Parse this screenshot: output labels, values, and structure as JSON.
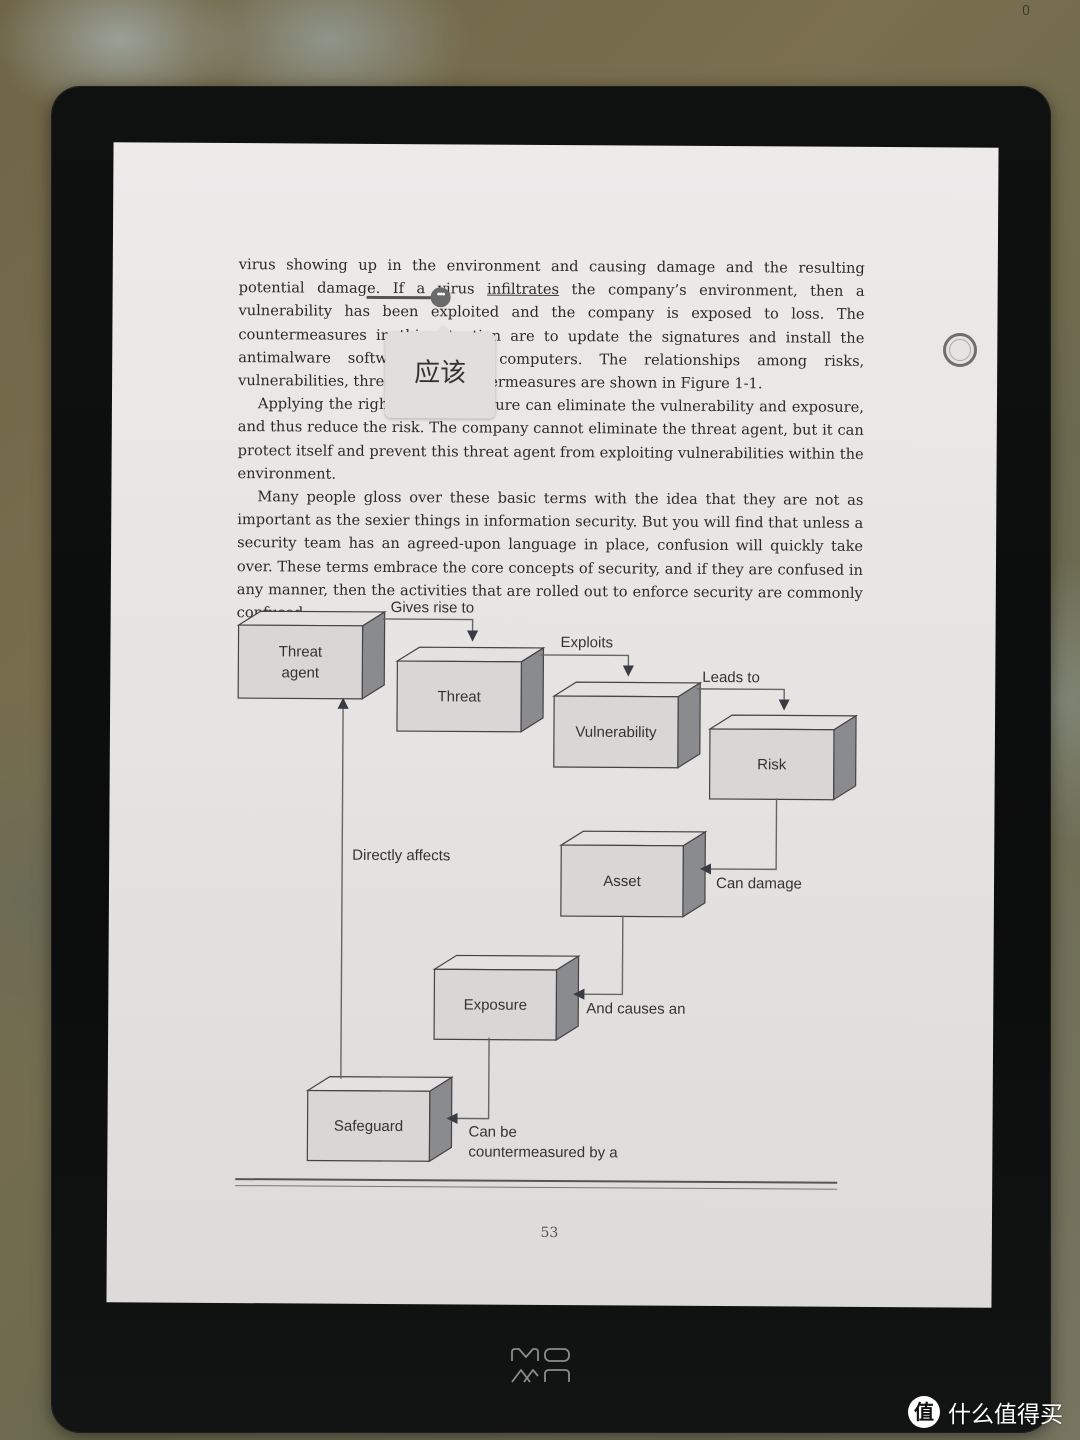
{
  "reader": {
    "brand": "MOAAN",
    "page_number": "53",
    "paragraphs": [
      {
        "indent": false,
        "before_link": "virus showing up in the environment and causing damage and the resulting potential damage. If a virus ",
        "link": "infiltrates",
        "after_link": " the company’s environment, then a vulnerability has been exploited and the company is exposed to loss. The countermeasures in this situation are to update the signatures and install the antimalware software on all computers. The relationships among risks, vulnerabilities, threats, and countermeasures are shown in Figure 1-1."
      },
      {
        "indent": true,
        "text": "Applying the right countermeasure can eliminate the vulnerability and exposure, and thus reduce the risk. The company cannot eliminate the threat agent, but it can protect itself and prevent this threat agent from exploiting vulnerabilities within the environment."
      },
      {
        "indent": true,
        "text": "Many people gloss over these basic terms with the idea that they are not as important as the sexier things in information security. But you will find that unless a security team has an agreed-upon language in place, confusion will quickly take over. These terms embrace the core concepts of security, and if they are confused in any manner, then the activities that are rolled out to enforce security are commonly confused."
      }
    ],
    "selection": {
      "selected_word": "infiltrates",
      "handle_icon": "more-dots-icon",
      "translation_popup": "应该"
    }
  },
  "figure": {
    "nodes": {
      "threat_agent": [
        "Threat",
        "agent"
      ],
      "threat": "Threat",
      "vulnerability": "Vulnerability",
      "risk": "Risk",
      "asset": "Asset",
      "exposure": "Exposure",
      "safeguard": "Safeguard"
    },
    "edges": {
      "gives_rise_to": "Gives rise to",
      "exploits": "Exploits",
      "leads_to": "Leads to",
      "can_damage": "Can damage",
      "and_causes_an": "And causes an",
      "can_be": "Can be",
      "countermeasured_by": "countermeasured by a",
      "directly_affects": "Directly affects"
    }
  },
  "watermark": {
    "badge": "值",
    "text": "什么值得买"
  }
}
